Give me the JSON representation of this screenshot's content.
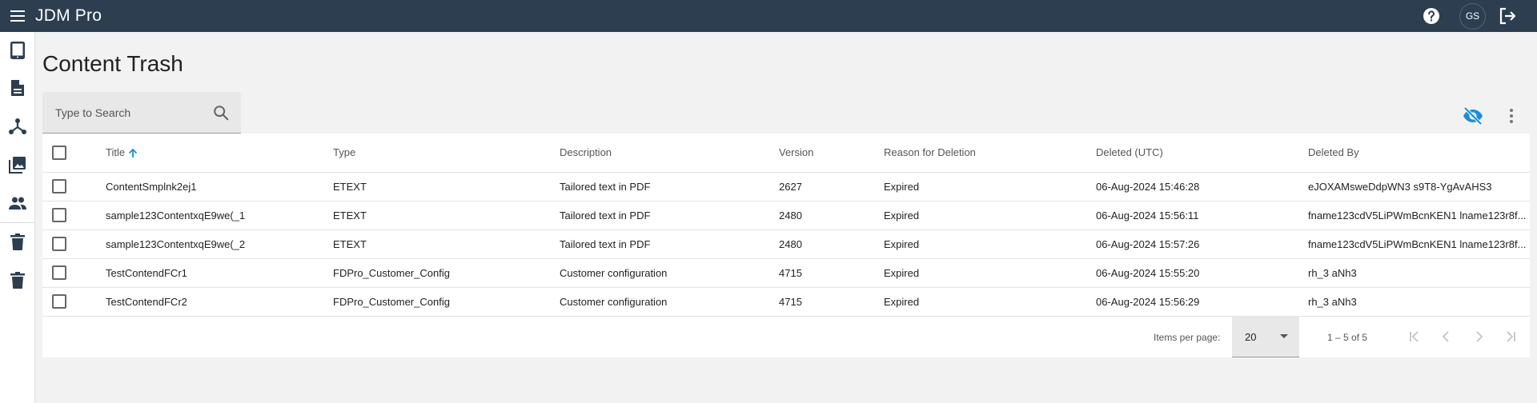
{
  "app": {
    "title": "JDM Pro",
    "avatar_initials": "GS"
  },
  "header": {
    "menu_icon": "hamburger-menu-icon",
    "help_icon": "help-circle-icon",
    "logout_icon": "logout-icon"
  },
  "sidebar": {
    "items": [
      {
        "icon": "tablet-icon"
      },
      {
        "icon": "document-icon"
      },
      {
        "icon": "hierarchy-icon"
      },
      {
        "icon": "image-library-icon"
      },
      {
        "icon": "people-icon"
      },
      {
        "icon": "trash-icon"
      },
      {
        "icon": "trash-icon"
      }
    ]
  },
  "page": {
    "title": "Content Trash"
  },
  "search": {
    "placeholder": "Type to Search",
    "value": ""
  },
  "toolbar": {
    "visibility_icon": "visibility-off-icon",
    "more_icon": "more-vertical-icon",
    "accent": "#1e8ed4"
  },
  "table": {
    "columns": [
      "Title",
      "Type",
      "Description",
      "Version",
      "Reason for Deletion",
      "Deleted (UTC)",
      "Deleted By"
    ],
    "sorted_column": "Title",
    "sort_direction": "asc",
    "rows": [
      {
        "title": "ContentSmplnk2ej1",
        "type": "ETEXT",
        "description": "Tailored text in PDF",
        "version": "2627",
        "reason": "Expired",
        "deleted": "06-Aug-2024 15:46:28",
        "deleted_by": "eJOXAMsweDdpWN3 s9T8-YgAvAHS3"
      },
      {
        "title": "sample123ContentxqE9we(_1",
        "type": "ETEXT",
        "description": "Tailored text in PDF",
        "version": "2480",
        "reason": "Expired",
        "deleted": "06-Aug-2024 15:56:11",
        "deleted_by": "fname123cdV5LiPWmBcnKEN1 lname123r8f..."
      },
      {
        "title": "sample123ContentxqE9we(_2",
        "type": "ETEXT",
        "description": "Tailored text in PDF",
        "version": "2480",
        "reason": "Expired",
        "deleted": "06-Aug-2024 15:57:26",
        "deleted_by": "fname123cdV5LiPWmBcnKEN1 lname123r8f..."
      },
      {
        "title": "TestContendFCr1",
        "type": "FDPro_Customer_Config",
        "description": "Customer configuration",
        "version": "4715",
        "reason": "Expired",
        "deleted": "06-Aug-2024 15:55:20",
        "deleted_by": "rh_3 aNh3"
      },
      {
        "title": "TestContendFCr2",
        "type": "FDPro_Customer_Config",
        "description": "Customer configuration",
        "version": "4715",
        "reason": "Expired",
        "deleted": "06-Aug-2024 15:56:29",
        "deleted_by": "rh_3 aNh3"
      }
    ]
  },
  "paginator": {
    "items_per_page_label": "Items per page:",
    "items_per_page": "20",
    "range_label": "1 – 5 of 5"
  }
}
